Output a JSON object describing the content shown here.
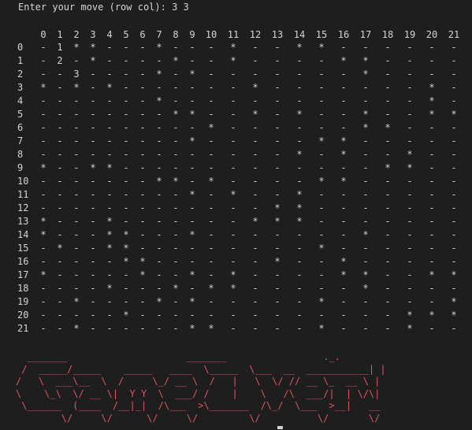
{
  "terminal": {
    "prompt": "Enter your move (row col): ",
    "input": "3 3"
  },
  "board": {
    "col_headers": [
      "0",
      "1",
      "2",
      "3",
      "4",
      "5",
      "6",
      "7",
      "8",
      "9",
      "10",
      "11",
      "12",
      "13",
      "14",
      "15",
      "16",
      "17",
      "18",
      "19",
      "20",
      "21"
    ],
    "row_headers": [
      "0",
      "1",
      "2",
      "3",
      "4",
      "5",
      "6",
      "7",
      "8",
      "9",
      "10",
      "11",
      "12",
      "13",
      "14",
      "15",
      "16",
      "17",
      "18",
      "19",
      "20",
      "21"
    ],
    "rows": [
      "- 1 * * - - - * - - - * - - * * - - - - - -",
      "- 2 - * - - - - * - - * - - - - * * - - - -",
      "- - 3 - - - - * - * - - - - - - - * - - - -",
      "* - * - * - - - - - - - * - - - - - - - * -",
      "- - - - - - - * - - - - - - - - - - - - * -",
      "- - - - - - - - * * - - * - * - - * - - * *",
      "- - - - - - - - - - * - - - - - - * * - - -",
      "- - - - - - - - - * - - - - - * * - - - - -",
      "- - - - - - - - - - - - - - * - * - - * - -",
      "* - - * * - - - - - - - - - - - - - * * - -",
      "- - - - - - - * * - * - - - - * * - - - - -",
      "- - - - - - - - - * - * - - * - - - - - - -",
      "- - - - - - - - - - - - - * * - - - - - - -",
      "* - - - * - - - - - - - * * * - - - - - - -",
      "* - - - * * - - - * - - - - - - - * - - - -",
      "- * - - * * - - - - - - - - - * - - - - - -",
      "- - - - - * * - - - - - - * - - * - - - - -",
      "* - - - - - * - - * - * - - - - * * - - * *",
      "- - - - * - - - * - * * - - - - - * - - - -",
      "- - * - - - - * - * - - - - - * - - - - - *",
      "- - - - - * - - - - - - - - - - - - - * * *",
      "- - * - - - - - - * * - - - - * - - - * - -"
    ]
  },
  "banner": {
    "text": "  _______                     _______                 ._.\n /  _____/_____    _____   ____  \\_____  \\___  __  ___________| |\n/   \\  ___\\__  \\  /     \\_/ __ \\  /   |   \\  \\/ // __ \\_  __ \\ |\n\\    \\_\\  \\/ __ \\|  Y Y  \\  ___/ /    |    \\   /\\  ___/|  | \\/\\|\n \\______  (____  /__|_|  /\\___  >\\_______  /\\_/  \\___  >__|   __\n        \\/     \\/      \\/     \\/         \\/          \\/       \\/",
    "color": "#e05561"
  }
}
